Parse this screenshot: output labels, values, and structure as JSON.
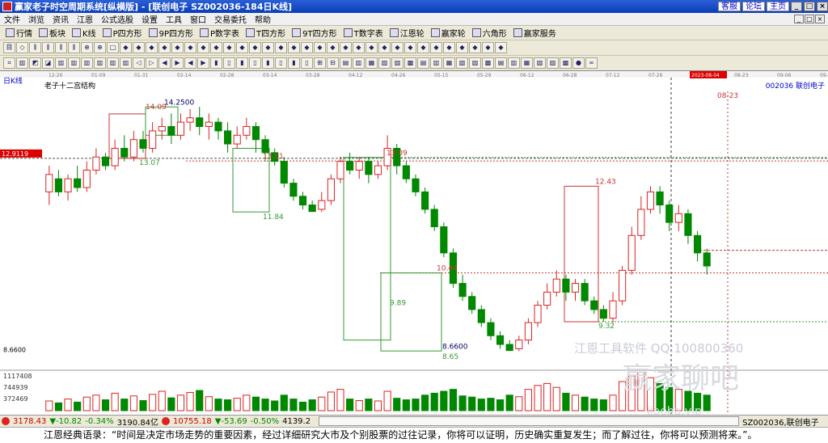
{
  "window": {
    "title": "赢家老子时空周期系统[纵横版] - [联创电子  SZ002036-184日K线]",
    "links": [
      "客服",
      "论坛",
      "主页"
    ],
    "win_buttons": [
      "_",
      "□",
      "×"
    ]
  },
  "menu": [
    "文件",
    "浏览",
    "资讯",
    "江恩",
    "公式选股",
    "设置",
    "工具",
    "窗口",
    "交易委托",
    "帮助"
  ],
  "toolbar1": [
    {
      "label": "行情",
      "icon": "grid-icon"
    },
    {
      "label": "板块",
      "icon": "blocks-icon"
    },
    {
      "label": "K线",
      "icon": "kline-icon"
    },
    {
      "label": "P四方形",
      "icon": "p-square-icon"
    },
    {
      "label": "9P四方形",
      "icon": "9p-square-icon"
    },
    {
      "label": "P数字表",
      "icon": "p-table-icon"
    },
    {
      "label": "T四方形",
      "icon": "t-square-icon"
    },
    {
      "label": "9T四方形",
      "icon": "9t-square-icon"
    },
    {
      "label": "T数字表",
      "icon": "t-table-icon"
    },
    {
      "label": "江恩轮",
      "icon": "gann-wheel-icon"
    },
    {
      "label": "赢家轮",
      "icon": "winner-wheel-icon"
    },
    {
      "label": "六角形",
      "icon": "hexagon-icon"
    },
    {
      "label": "赢家服务",
      "icon": "service-icon"
    }
  ],
  "chart": {
    "period_label": "日K线",
    "indicator_label": "老子十二宫结构",
    "stock_label": "002036  联创电子",
    "date_ticks": [
      "12-26",
      "01-09",
      "01-31",
      "02-14",
      "02-28",
      "03-14",
      "03-28",
      "04-12",
      "04-26",
      "05-15",
      "05-29",
      "06-12",
      "06-28",
      "07-12",
      "07-26",
      "2023-08-04",
      "08-23",
      "09-06",
      "09-20"
    ],
    "current_price_box": "12.9119",
    "min_price_label": "8.6600",
    "price_annotations": [
      "14.09",
      "14.2500",
      "13.07",
      "13.01",
      "13.09",
      "11.84",
      "10.44",
      "9.89",
      "8.6600",
      "8.65",
      "12.43",
      "9.32",
      "08-23"
    ],
    "volume_ticks": [
      "1117408",
      "744939",
      "372469"
    ],
    "watermark": [
      "江恩工具软件  QQ:100800360",
      "赢家聊吧",
      "liaoba.vip"
    ]
  },
  "chart_data": {
    "type": "candlestick",
    "title": "老子十二宫结构",
    "y_range": [
      8.3,
      14.7
    ],
    "x_ticks": [
      "12-26",
      "01-09",
      "01-31",
      "02-14",
      "02-28",
      "03-14",
      "03-28",
      "04-12",
      "04-26",
      "05-15",
      "05-29",
      "06-12",
      "06-28",
      "07-12",
      "07-26",
      "2023-08-04",
      "08-23",
      "09-06",
      "09-20"
    ],
    "levels": [
      {
        "label": "13.07",
        "value": 13.07
      },
      {
        "label": "13.01",
        "value": 13.01
      },
      {
        "label": "13.09",
        "value": 13.09
      },
      {
        "label": "11.84",
        "value": 11.84
      },
      {
        "label": "10.44",
        "value": 10.44
      },
      {
        "label": "9.89",
        "value": 9.89
      },
      {
        "label": "8.65",
        "value": 8.65
      },
      {
        "label": "12.43",
        "value": 12.43
      },
      {
        "label": "9.32",
        "value": 9.32
      },
      {
        "label": "14.09",
        "value": 14.09
      },
      {
        "label": "14.2500",
        "value": 14.25
      },
      {
        "label": "8.6600",
        "value": 8.66
      }
    ],
    "candles": [
      [
        12.3,
        12.7,
        12.9,
        12.0
      ],
      [
        12.6,
        12.3,
        12.8,
        12.2
      ],
      [
        12.3,
        12.6,
        12.7,
        12.1
      ],
      [
        12.6,
        12.4,
        12.9,
        12.3
      ],
      [
        12.4,
        12.8,
        13.0,
        12.3
      ],
      [
        12.8,
        13.1,
        13.3,
        12.7
      ],
      [
        13.1,
        12.9,
        13.2,
        12.8
      ],
      [
        12.9,
        13.3,
        13.5,
        12.8
      ],
      [
        13.3,
        13.1,
        13.6,
        13.0
      ],
      [
        13.1,
        13.5,
        13.7,
        13.0
      ],
      [
        13.5,
        13.3,
        13.7,
        13.2
      ],
      [
        13.3,
        13.7,
        13.9,
        13.2
      ],
      [
        13.7,
        13.8,
        14.0,
        13.5
      ],
      [
        13.8,
        13.6,
        14.1,
        13.4
      ],
      [
        13.6,
        13.9,
        14.1,
        13.5
      ],
      [
        13.9,
        14.0,
        14.2,
        13.7
      ],
      [
        14.0,
        13.8,
        14.25,
        13.6
      ],
      [
        13.8,
        13.9,
        14.1,
        13.5
      ],
      [
        13.9,
        13.7,
        14.0,
        13.5
      ],
      [
        13.7,
        13.4,
        13.9,
        13.2
      ],
      [
        13.4,
        13.6,
        13.8,
        13.3
      ],
      [
        13.6,
        13.8,
        14.0,
        13.5
      ],
      [
        13.8,
        13.5,
        13.9,
        13.2
      ],
      [
        13.5,
        13.2,
        13.6,
        13.0
      ],
      [
        13.2,
        13.0,
        13.3,
        12.9
      ],
      [
        13.0,
        12.5,
        13.1,
        12.4
      ],
      [
        12.5,
        12.2,
        12.6,
        12.1
      ],
      [
        12.2,
        12.0,
        12.3,
        11.9
      ],
      [
        12.0,
        11.85,
        12.1,
        11.84
      ],
      [
        11.9,
        12.1,
        12.3,
        11.84
      ],
      [
        12.1,
        12.6,
        12.7,
        12.0
      ],
      [
        12.6,
        13.0,
        13.1,
        12.5
      ],
      [
        13.0,
        12.8,
        13.2,
        12.7
      ],
      [
        12.8,
        13.0,
        13.1,
        12.6
      ],
      [
        13.0,
        12.7,
        13.1,
        12.5
      ],
      [
        12.7,
        12.9,
        13.0,
        12.6
      ],
      [
        12.9,
        13.3,
        13.6,
        12.8
      ],
      [
        13.3,
        12.9,
        13.4,
        12.7
      ],
      [
        12.9,
        12.6,
        13.0,
        12.5
      ],
      [
        12.6,
        12.3,
        12.7,
        12.2
      ],
      [
        12.3,
        11.9,
        12.4,
        11.8
      ],
      [
        11.9,
        11.5,
        12.0,
        11.4
      ],
      [
        11.5,
        10.9,
        11.6,
        10.8
      ],
      [
        10.9,
        10.2,
        11.0,
        10.1
      ],
      [
        10.2,
        9.9,
        10.4,
        9.8
      ],
      [
        9.9,
        9.6,
        10.0,
        9.5
      ],
      [
        9.6,
        9.3,
        9.7,
        9.2
      ],
      [
        9.3,
        9.0,
        9.4,
        8.9
      ],
      [
        9.0,
        8.8,
        9.1,
        8.7
      ],
      [
        8.8,
        8.66,
        8.9,
        8.65
      ],
      [
        8.7,
        8.9,
        9.0,
        8.65
      ],
      [
        8.9,
        9.3,
        9.4,
        8.8
      ],
      [
        9.3,
        9.7,
        9.8,
        9.2
      ],
      [
        9.7,
        10.0,
        10.2,
        9.6
      ],
      [
        10.0,
        10.3,
        10.5,
        9.9
      ],
      [
        10.3,
        10.0,
        10.4,
        9.8
      ],
      [
        10.0,
        10.2,
        10.3,
        9.8
      ],
      [
        10.2,
        9.8,
        10.3,
        9.7
      ],
      [
        9.8,
        9.6,
        9.9,
        9.5
      ],
      [
        9.6,
        9.4,
        9.7,
        9.32
      ],
      [
        9.4,
        9.8,
        10.0,
        9.3
      ],
      [
        9.8,
        10.5,
        10.6,
        9.7
      ],
      [
        10.5,
        11.3,
        11.5,
        10.4
      ],
      [
        11.3,
        11.9,
        12.2,
        11.2
      ],
      [
        11.9,
        12.3,
        12.43,
        11.8
      ],
      [
        12.3,
        12.0,
        12.43,
        11.8
      ],
      [
        12.0,
        11.6,
        12.1,
        11.4
      ],
      [
        11.6,
        11.8,
        12.0,
        11.4
      ],
      [
        11.8,
        11.3,
        11.9,
        11.1
      ],
      [
        11.3,
        10.9,
        11.4,
        10.7
      ],
      [
        10.9,
        10.6,
        11.0,
        10.4
      ]
    ],
    "volume": [
      0.25,
      0.2,
      0.3,
      0.22,
      0.35,
      0.4,
      0.28,
      0.45,
      0.3,
      0.38,
      0.26,
      0.42,
      0.5,
      0.33,
      0.4,
      0.47,
      0.52,
      0.36,
      0.3,
      0.28,
      0.32,
      0.4,
      0.35,
      0.3,
      0.25,
      0.4,
      0.3,
      0.22,
      0.28,
      0.35,
      0.48,
      0.55,
      0.3,
      0.26,
      0.3,
      0.25,
      0.5,
      0.32,
      0.28,
      0.3,
      0.4,
      0.45,
      0.5,
      0.55,
      0.38,
      0.35,
      0.3,
      0.32,
      0.28,
      0.4,
      0.36,
      0.55,
      0.65,
      0.7,
      0.6,
      0.45,
      0.4,
      0.35,
      0.3,
      0.28,
      0.4,
      0.75,
      0.9,
      1.0,
      0.85,
      0.7,
      0.6,
      0.55,
      0.5,
      0.45,
      0.4
    ]
  },
  "status": {
    "sh_index": "3178.43",
    "sh_change": "▼-10.82",
    "sh_pct": "-0.34%",
    "sh_amount": "3190.84亿",
    "sz_index": "10755.18",
    "sz_change": "▼-53.69",
    "sz_pct": "-0.50%",
    "sz_amount": "4139.2",
    "right": "SZ002036,联创电子"
  },
  "quote": "江恩经典语录：“时间是决定市场走势的重要因素，经过详细研究大市及个别股票的过往记录，你将可以证明，历史确实重复发生；而了解过往，你将可以预测将来。”。"
}
